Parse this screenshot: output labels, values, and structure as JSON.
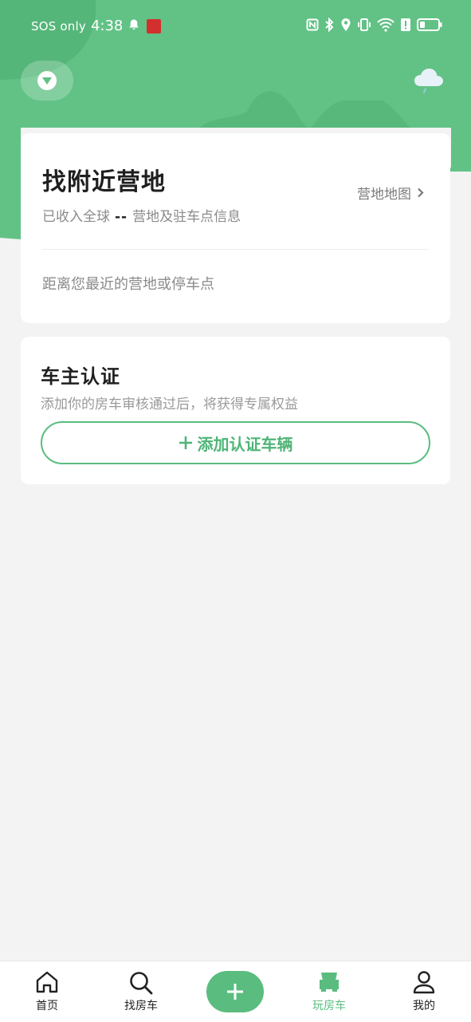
{
  "status_bar": {
    "carrier": "SOS only",
    "time": "4:38"
  },
  "colors": {
    "primary_green": "#5abd7f",
    "header_green": "#62c286"
  },
  "header": {
    "dropdown_icon": "chevron-down-icon",
    "weather_icon": "cloud-rain-icon"
  },
  "camp_card": {
    "title": "找附近营地",
    "subtitle_prefix": "已收入全球",
    "count": "--",
    "subtitle_suffix": "营地及驻车点信息",
    "map_link": "营地地图",
    "nearest_text": "距离您最近的营地或停车点"
  },
  "owner_card": {
    "title": "车主认证",
    "description": "添加你的房车审核通过后，将获得专属权益",
    "add_button": "添加认证车辆"
  },
  "tabbar": {
    "items": [
      {
        "label": "首页",
        "icon": "home-icon"
      },
      {
        "label": "找房车",
        "icon": "search-icon"
      },
      {
        "label": "",
        "icon": "plus-icon"
      },
      {
        "label": "玩房车",
        "icon": "rv-icon"
      },
      {
        "label": "我的",
        "icon": "user-icon"
      }
    ],
    "active_index": 3
  }
}
